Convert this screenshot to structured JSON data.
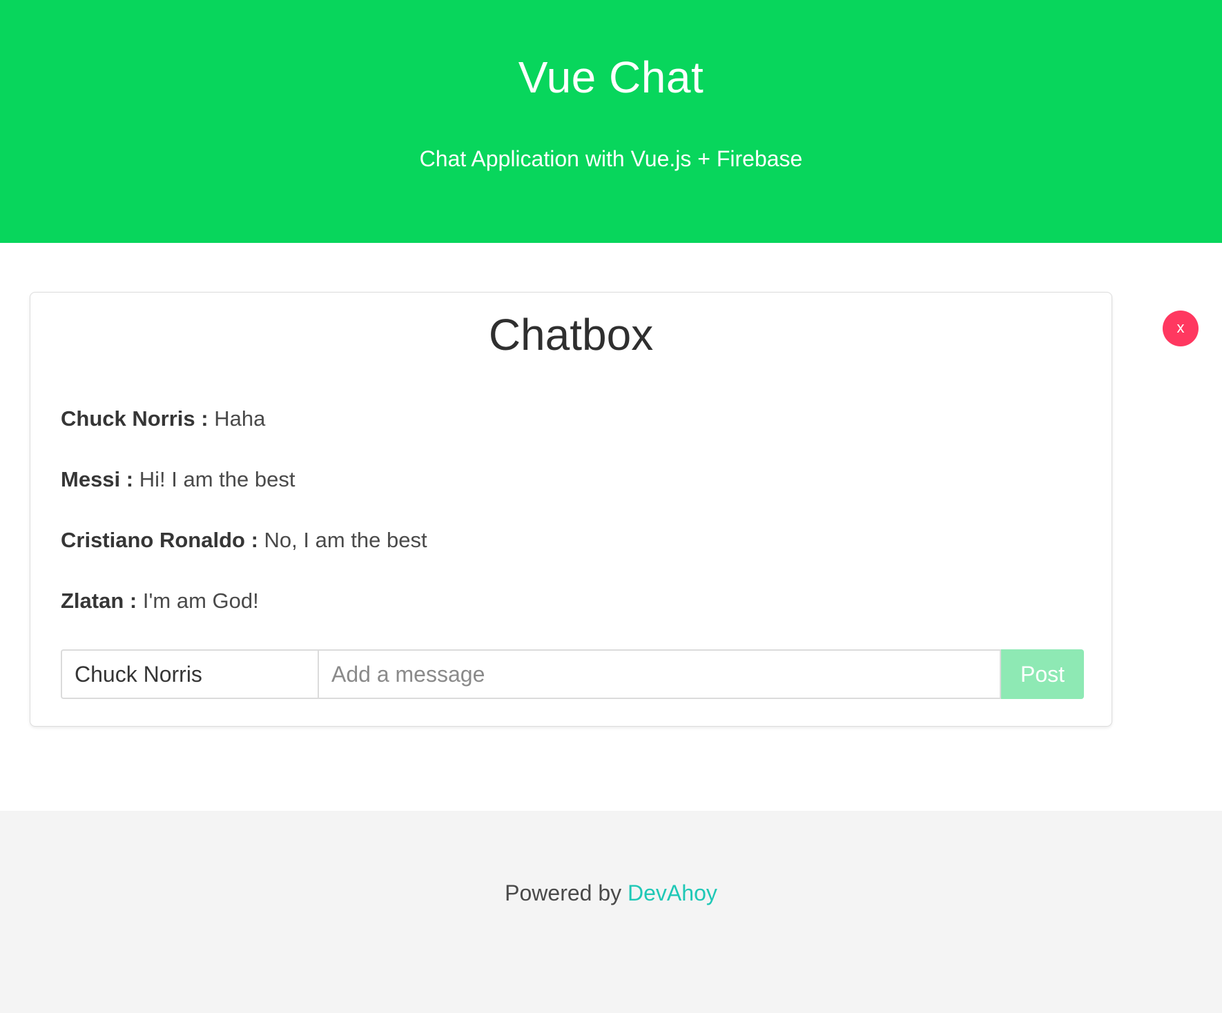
{
  "header": {
    "title": "Vue Chat",
    "subtitle": "Chat Application with Vue.js + Firebase",
    "background_color": "#08d65c"
  },
  "chatbox": {
    "title": "Chatbox",
    "messages": [
      {
        "author": "Chuck Norris",
        "separator": " : ",
        "text": "Haha"
      },
      {
        "author": "Messi",
        "separator": " : ",
        "text": "Hi! I am the best"
      },
      {
        "author": "Cristiano Ronaldo",
        "separator": " : ",
        "text": "No, I am the best"
      },
      {
        "author": "Zlatan",
        "separator": " : ",
        "text": "I'm am God!"
      }
    ],
    "composer": {
      "name_value": "Chuck Norris",
      "message_placeholder": "Add a message",
      "message_value": "",
      "post_label": "Post"
    },
    "close_label": "x",
    "close_icon": "close-icon"
  },
  "footer": {
    "powered_text": "Powered by",
    "link_text": "DevAhoy",
    "link_color": "#1fc8b6"
  }
}
